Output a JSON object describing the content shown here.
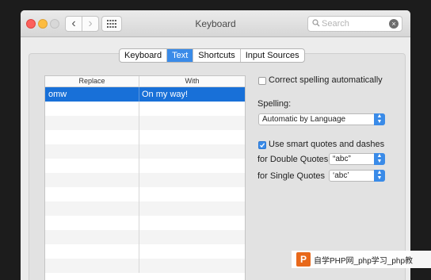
{
  "window": {
    "title": "Keyboard"
  },
  "search": {
    "placeholder": "Search",
    "clear_glyph": "×"
  },
  "nav": {
    "back": "‹",
    "forward": "›"
  },
  "tabs": [
    {
      "label": "Keyboard",
      "active": false
    },
    {
      "label": "Text",
      "active": true
    },
    {
      "label": "Shortcuts",
      "active": false
    },
    {
      "label": "Input Sources",
      "active": false
    }
  ],
  "table": {
    "headers": [
      "Replace",
      "With"
    ],
    "rows": [
      {
        "replace": "omw",
        "with": "On my way!",
        "selected": true
      }
    ],
    "empty_row_count": 12
  },
  "options": {
    "correct_spelling": {
      "label": "Correct spelling automatically",
      "checked": false
    },
    "spelling_label": "Spelling:",
    "spelling_value": "Automatic by Language",
    "smart_quotes": {
      "label": "Use smart quotes and dashes",
      "checked": true
    },
    "double_quotes_label": "for Double Quotes",
    "double_quotes_value": "“abc”",
    "single_quotes_label": "for Single Quotes",
    "single_quotes_value": "‘abc’"
  },
  "watermark": {
    "logo": "P",
    "text": "自学PHP网_php学习_php教"
  },
  "colors": {
    "accent": "#3a8be8",
    "selection": "#1870d8",
    "close": "#fc605c",
    "minimize": "#fdbc40"
  },
  "icons": [
    "back-chevron-icon",
    "forward-chevron-icon",
    "grid-icon",
    "search-icon",
    "clear-icon",
    "checkmark-icon",
    "updown-arrow-icon"
  ]
}
